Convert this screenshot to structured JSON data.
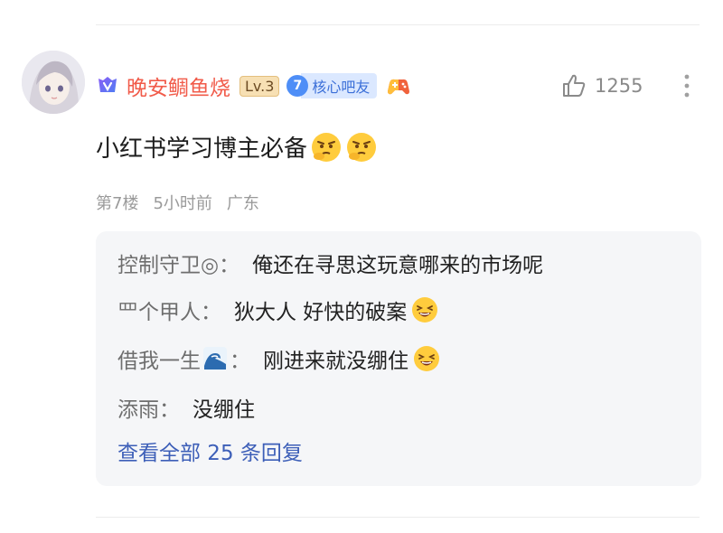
{
  "comment": {
    "username": "晚安鲷鱼烧",
    "level": "Lv.3",
    "member_level": "7",
    "member_title": "核心吧友",
    "likes": "1255",
    "text": "小红书学习博主必备",
    "floor": "第7楼",
    "time": "5小时前",
    "location": "广东"
  },
  "replies": [
    {
      "author": "控制守卫◎",
      "separator": "：",
      "text": "俺还在寻思这玩意哪来的市场呢"
    },
    {
      "author": "罒个甲人",
      "separator": "：",
      "text": "狄大人 好快的破案"
    },
    {
      "author": "借我一生",
      "separator": "：",
      "text": "刚进来就没绷住"
    },
    {
      "author": "添雨",
      "separator": "：",
      "text": "没绷住"
    }
  ],
  "view_all": "查看全部 25 条回复",
  "icons": {
    "vip": "vip-crown-icon",
    "game": "game-controller-icon",
    "like": "thumbs-up-icon",
    "more": "more-vertical-icon",
    "face": "thinking-face-emoji",
    "laugh": "laughing-face-emoji",
    "wave": "wave-emoji"
  },
  "colors": {
    "username": "#f15b4a",
    "link": "#3d5fb8",
    "member_badge": "#4e8ef7"
  }
}
